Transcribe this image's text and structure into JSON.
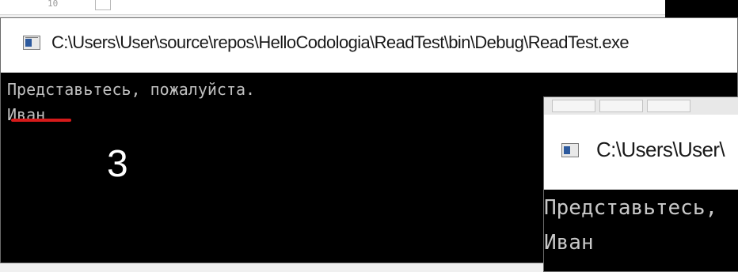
{
  "main_window": {
    "title": "C:\\Users\\User\\source\\repos\\HelloCodologia\\ReadTest\\bin\\Debug\\ReadTest.exe",
    "icon": "console-app-icon",
    "console_lines": [
      "Представьтесь, пожалуйста.",
      "Иван"
    ]
  },
  "annotation": {
    "number": "3",
    "underline_color": "#d61a1a"
  },
  "secondary_window": {
    "title": "C:\\Users\\User\\",
    "icon": "console-app-icon",
    "console_lines": [
      "Представьтесь,",
      "Иван"
    ]
  },
  "background": {
    "fragment": "10"
  },
  "colors": {
    "console_bg": "#000000",
    "console_text": "#c0c0c0",
    "titlebar_bg": "#ffffff"
  }
}
